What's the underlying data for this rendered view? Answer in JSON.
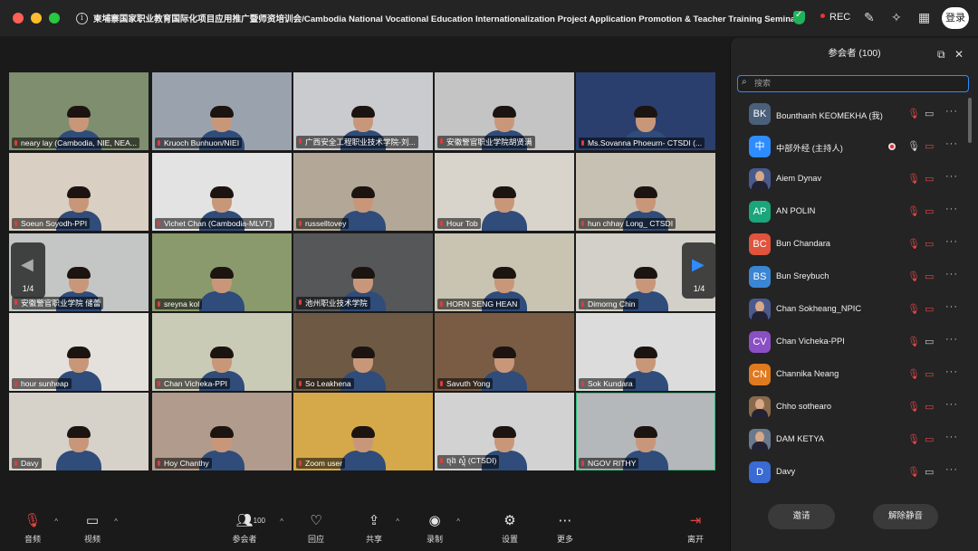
{
  "window": {
    "title": "柬埔寨国家职业教育国际化项目应用推广暨师资培训会/Cambodia National Vocational Education Internationalization Project Application Promotion & Teacher Training Seminar",
    "rec_label": "REC",
    "login_label": "登录"
  },
  "gallery": {
    "page_indicator_left": "1/4",
    "page_indicator_right": "1/4",
    "tiles": [
      {
        "name": "neary lay (Cambodia, NIE, NEA...",
        "bg": "#7e8e6e"
      },
      {
        "name": "Kruoch Bunhuon/NIEI",
        "bg": "#9aa3ad"
      },
      {
        "name": "广西安全工程职业技术学院-刘...",
        "bg": "#c9cbcf"
      },
      {
        "name": "安徽警官职业学院胡贤满",
        "bg": "#c4c4c4"
      },
      {
        "name": "Ms.Sovanna Phoeurn- CTSDI (...",
        "bg": "#2a3f6e"
      },
      {
        "name": "Soeun Soyodh-PPI",
        "bg": "#d9cfc2"
      },
      {
        "name": "Vichet Chan (Cambodia-MLVT)",
        "bg": "#e3e3e3"
      },
      {
        "name": "russelltovey",
        "bg": "#b3a898"
      },
      {
        "name": "Hour Tob",
        "bg": "#d8d4cc"
      },
      {
        "name": "hun chhay Long_ CTSDI",
        "bg": "#c7c1b4"
      },
      {
        "name": "安徽警官职业学院 储蕾",
        "bg": "#c4c6c6"
      },
      {
        "name": "sreyna kol",
        "bg": "#8a9a6c"
      },
      {
        "name": "池州职业技术学院",
        "bg": "#555759"
      },
      {
        "name": "HORN SENG HEAN",
        "bg": "#c9c3b2"
      },
      {
        "name": "Dimorng Chin",
        "bg": "#d2d0c8"
      },
      {
        "name": "hour sunheap",
        "bg": "#e4e1dc"
      },
      {
        "name": "Chan Vicheka-PPI",
        "bg": "#c9cbb7"
      },
      {
        "name": "So Leakhena",
        "bg": "#6e5a44"
      },
      {
        "name": "Savuth Yong",
        "bg": "#7a5c45"
      },
      {
        "name": "Sok Kundara",
        "bg": "#dcdcdc"
      },
      {
        "name": "Davy",
        "bg": "#d6d1c9"
      },
      {
        "name": "Hoy Chanthy",
        "bg": "#b19b8c"
      },
      {
        "name": "Zoom user",
        "bg": "#d5a84a"
      },
      {
        "name": "ចុង ស្ទុំ (CTSDI)",
        "bg": "#d2d2d2"
      },
      {
        "name": "NGOV RITHY",
        "bg": "#b5b8bb"
      }
    ]
  },
  "toolbar": {
    "audio": "音频",
    "video": "视频",
    "participants": "参会者",
    "participants_count": "100",
    "reactions": "回应",
    "share": "共享",
    "record": "录制",
    "settings": "设置",
    "more": "更多",
    "leave": "离开"
  },
  "panel": {
    "title": "参会者 (100)",
    "search_placeholder": "搜索",
    "invite_button": "邀请",
    "unmute_all_button": "解除静音",
    "participants": [
      {
        "initials": "BK",
        "name": "Bounthanh KEOMEKHA (我)",
        "color": "#4a5f7a",
        "mic_muted": true,
        "cam_off": false
      },
      {
        "initials": "中",
        "name": "中部外经 (主持人)",
        "color": "#2d8cff",
        "mic_muted": false,
        "cam_off": true,
        "host": true
      },
      {
        "initials": "",
        "name": "Aiem Dynav",
        "color": "#4a5a8c",
        "mic_muted": true,
        "cam_off": true,
        "photo": true
      },
      {
        "initials": "AP",
        "name": "AN POLIN",
        "color": "#1aa57a",
        "mic_muted": true,
        "cam_off": true
      },
      {
        "initials": "BC",
        "name": "Bun Chandara",
        "color": "#e0533d",
        "mic_muted": true,
        "cam_off": true
      },
      {
        "initials": "BS",
        "name": "Bun Sreybuch",
        "color": "#3a86d4",
        "mic_muted": true,
        "cam_off": true
      },
      {
        "initials": "",
        "name": "Chan Sokheang_NPIC",
        "color": "#4a5a8c",
        "mic_muted": true,
        "cam_off": true,
        "photo": true
      },
      {
        "initials": "CV",
        "name": "Chan Vicheka-PPI",
        "color": "#8b4fc4",
        "mic_muted": true,
        "cam_off": false
      },
      {
        "initials": "CN",
        "name": "Channika Neang",
        "color": "#e07a1f",
        "mic_muted": true,
        "cam_off": true
      },
      {
        "initials": "",
        "name": "Chho sothearo",
        "color": "#8a6a4a",
        "mic_muted": true,
        "cam_off": true,
        "photo": true
      },
      {
        "initials": "",
        "name": "DAM KETYA",
        "color": "#6a7a8c",
        "mic_muted": true,
        "cam_off": true,
        "photo": true
      },
      {
        "initials": "D",
        "name": "Davy",
        "color": "#3a6ad4",
        "mic_muted": true,
        "cam_off": false
      }
    ]
  }
}
